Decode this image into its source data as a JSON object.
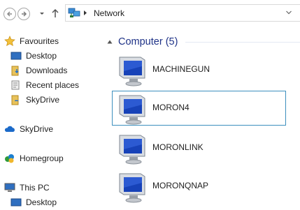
{
  "address_bar": {
    "breadcrumb": "Network"
  },
  "nav_pane": {
    "items": [
      {
        "label": "Favourites",
        "icon": "star-icon"
      },
      {
        "label": "Desktop",
        "icon": "desktop-icon"
      },
      {
        "label": "Downloads",
        "icon": "downloads-folder-icon"
      },
      {
        "label": "Recent places",
        "icon": "recent-places-icon"
      },
      {
        "label": "SkyDrive",
        "icon": "skydrive-folder-icon"
      },
      {
        "label": "SkyDrive",
        "icon": "cloud-icon"
      },
      {
        "label": "Homegroup",
        "icon": "homegroup-icon"
      },
      {
        "label": "This PC",
        "icon": "computer-icon"
      },
      {
        "label": "Desktop",
        "icon": "desktop-icon"
      }
    ]
  },
  "content": {
    "group_title": "Computer (5)",
    "computers": [
      {
        "name": "MACHINEGUN",
        "selected": false
      },
      {
        "name": "MORON4",
        "selected": true
      },
      {
        "name": "MORONLINK",
        "selected": false
      },
      {
        "name": "MORONQNAP",
        "selected": false
      }
    ]
  },
  "colors": {
    "group_title": "#1e3287",
    "selection_border": "#3c8fbe"
  }
}
